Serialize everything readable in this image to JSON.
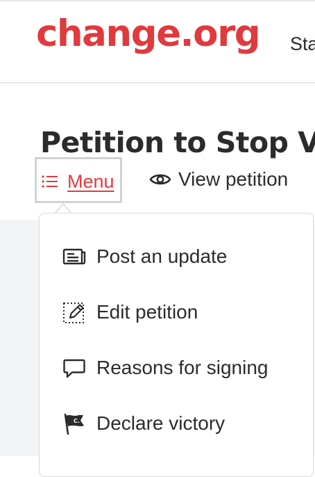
{
  "header": {
    "logo_text": "change.org",
    "nav_link": "Sta"
  },
  "page": {
    "title": "Petition to Stop V"
  },
  "toolbar": {
    "menu_label": "Menu",
    "menu_icon": "list-icon",
    "view_label": "View petition",
    "view_icon": "eye-icon"
  },
  "menu": {
    "items": [
      {
        "label": "Post an update",
        "icon": "post-update-icon"
      },
      {
        "label": "Edit petition",
        "icon": "edit-icon"
      },
      {
        "label": "Reasons for signing",
        "icon": "speech-bubble-icon"
      },
      {
        "label": "Declare victory",
        "icon": "victory-flag-icon"
      }
    ]
  },
  "colors": {
    "brand": "#e03a3e",
    "text": "#2b2b2b",
    "border": "#cfd3d6",
    "background_muted": "#f3f4f5"
  }
}
